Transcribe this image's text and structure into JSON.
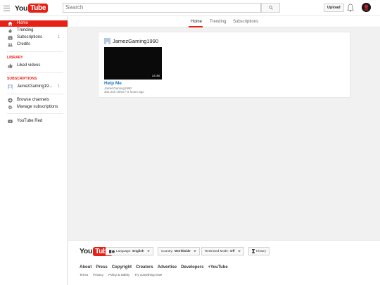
{
  "masthead": {
    "logo_you": "You",
    "logo_tube": "Tube",
    "search_placeholder": "Search",
    "upload_label": "Upload"
  },
  "sidebar": {
    "main_items": [
      {
        "label": "Home",
        "icon": "home-icon",
        "active": true
      },
      {
        "label": "Trending",
        "icon": "flame-icon"
      },
      {
        "label": "Subscriptions",
        "icon": "subscriptions-icon",
        "count": "1"
      },
      {
        "label": "Credits",
        "icon": "credits-icon"
      }
    ],
    "library_heading": "LIBRARY",
    "library_items": [
      {
        "label": "Liked videos",
        "icon": "thumbs-up-icon"
      }
    ],
    "subscriptions_heading": "SUBSCRIPTIONS",
    "subscription_items": [
      {
        "label": "JamezGaming19...",
        "count": "1"
      }
    ],
    "extra_items": [
      {
        "label": "Browse channels",
        "icon": "plus-circle-icon"
      },
      {
        "label": "Manage subscriptions",
        "icon": "gear-icon"
      }
    ],
    "red_items": [
      {
        "label": "YouTube Red",
        "icon": "youtube-red-icon"
      }
    ]
  },
  "tabs": [
    "Home",
    "Trending",
    "Subscriptions"
  ],
  "feed": {
    "channel_name": "JamezGaming1990",
    "video": {
      "duration": "14:46",
      "title": "Help Me",
      "channel": "JamezGaming1990",
      "meta": "302,220 views • 6 hours ago"
    }
  },
  "footer": {
    "language_label": "Language:",
    "language_value": "English",
    "country_label": "Country:",
    "country_value": "Worldwide",
    "restricted_label": "Restricted Mode:",
    "restricted_value": "Off",
    "history_label": "History",
    "links": [
      "About",
      "Press",
      "Copyright",
      "Creators",
      "Advertise",
      "Developers",
      "+YouTube"
    ],
    "sub_links": [
      "Terms",
      "Privacy",
      "Policy & Safety",
      "Try something new!"
    ]
  },
  "colors": {
    "brand_red": "#e62117",
    "link_blue": "#167ac6",
    "background": "#f1f1f1"
  }
}
